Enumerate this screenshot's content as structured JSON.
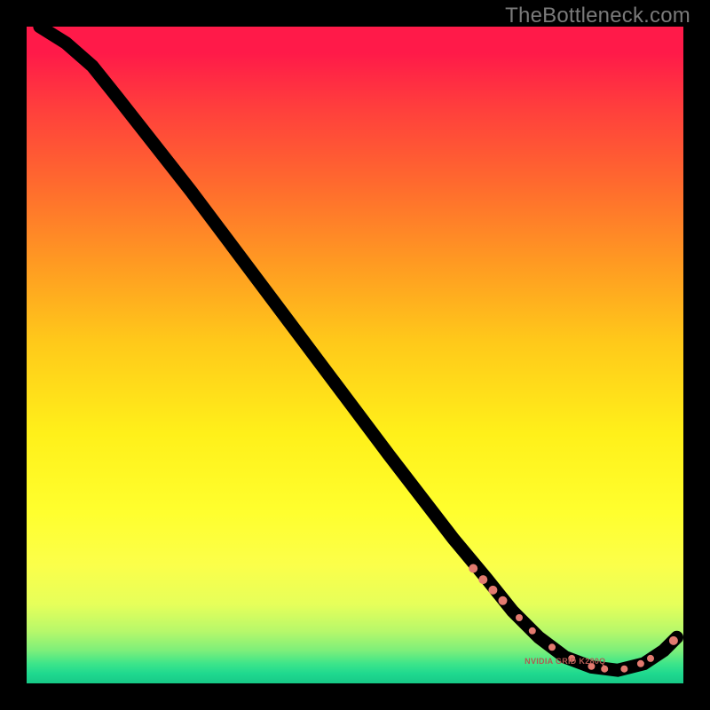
{
  "watermark": "TheBottleneck.com",
  "chart_data": {
    "type": "line",
    "title": "",
    "xlabel": "",
    "ylabel": "",
    "xlim": [
      0,
      100
    ],
    "ylim": [
      0,
      100
    ],
    "grid": false,
    "legend": false,
    "series": [
      {
        "name": "bottleneck-curve",
        "color": "#000000",
        "points": [
          {
            "x": 2.0,
            "y": 100.0
          },
          {
            "x": 6.0,
            "y": 97.5
          },
          {
            "x": 10.0,
            "y": 94.0
          },
          {
            "x": 14.0,
            "y": 89.0
          },
          {
            "x": 25.0,
            "y": 75.0
          },
          {
            "x": 40.0,
            "y": 55.0
          },
          {
            "x": 55.0,
            "y": 35.0
          },
          {
            "x": 65.0,
            "y": 22.0
          },
          {
            "x": 70.0,
            "y": 16.0
          },
          {
            "x": 74.0,
            "y": 11.0
          },
          {
            "x": 78.0,
            "y": 7.0
          },
          {
            "x": 82.0,
            "y": 4.0
          },
          {
            "x": 86.0,
            "y": 2.5
          },
          {
            "x": 90.0,
            "y": 2.0
          },
          {
            "x": 94.0,
            "y": 3.0
          },
          {
            "x": 97.0,
            "y": 5.0
          },
          {
            "x": 99.0,
            "y": 7.0
          }
        ]
      }
    ],
    "markers": [
      {
        "x": 68.0,
        "y": 17.5,
        "r": 5
      },
      {
        "x": 69.5,
        "y": 15.8,
        "r": 5
      },
      {
        "x": 71.0,
        "y": 14.2,
        "r": 5
      },
      {
        "x": 72.5,
        "y": 12.6,
        "r": 5
      },
      {
        "x": 75.0,
        "y": 10.0,
        "r": 4
      },
      {
        "x": 77.0,
        "y": 8.0,
        "r": 4
      },
      {
        "x": 80.0,
        "y": 5.5,
        "r": 4
      },
      {
        "x": 83.0,
        "y": 3.8,
        "r": 4
      },
      {
        "x": 86.0,
        "y": 2.6,
        "r": 4
      },
      {
        "x": 88.0,
        "y": 2.2,
        "r": 4
      },
      {
        "x": 91.0,
        "y": 2.2,
        "r": 4
      },
      {
        "x": 93.5,
        "y": 3.0,
        "r": 4
      },
      {
        "x": 95.0,
        "y": 3.8,
        "r": 4
      },
      {
        "x": 98.5,
        "y": 6.5,
        "r": 5
      }
    ],
    "annotations": [
      {
        "text": "NVIDIA GRID K280Q",
        "x": 82.0,
        "y": 3.0
      }
    ]
  },
  "colors": {
    "background": "#000000",
    "marker": "#e27a6f",
    "curve": "#000000",
    "watermark": "#7a7a7a"
  }
}
